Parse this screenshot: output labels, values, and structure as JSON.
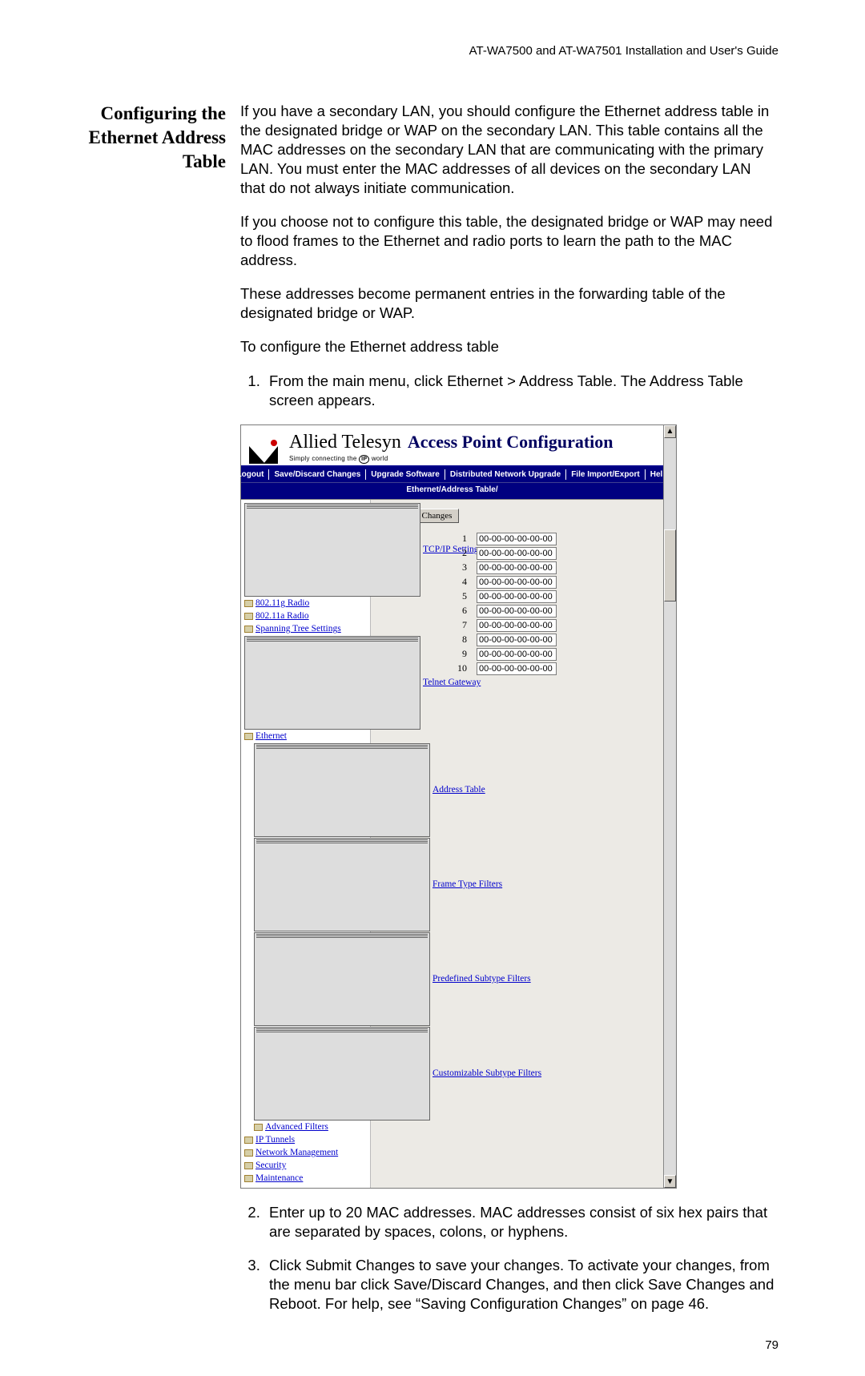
{
  "doc_header": "AT-WA7500 and AT-WA7501 Installation and User's Guide",
  "page_number": "79",
  "section_title": "Configuring the Ethernet Address Table",
  "paragraphs": {
    "p1": "If you have a secondary LAN, you should configure the Ethernet address table in the designated bridge or WAP on the secondary LAN. This table contains all the MAC addresses on the secondary LAN that are communicating with the primary LAN. You must enter the MAC addresses of all devices on the secondary LAN that do not always initiate communication.",
    "p2": "If you choose not to configure this table, the designated bridge or WAP may need to flood frames to the Ethernet and radio ports to learn the path to the MAC address.",
    "p3": "These addresses become permanent entries in the forwarding table of the designated bridge or WAP.",
    "p4": "To configure the Ethernet address table"
  },
  "steps": {
    "s1": "From the main menu, click Ethernet > Address Table. The Address Table screen appears.",
    "s2": "Enter up to 20 MAC addresses. MAC addresses consist of six hex pairs that are separated by spaces, colons, or hyphens.",
    "s3": "Click Submit Changes to save your changes. To activate your changes, from the menu bar click Save/Discard Changes, and then click Save Changes and Reboot. For help, see “Saving Configuration Changes” on page 46."
  },
  "screenshot": {
    "brand_main": "Allied Telesyn",
    "brand_tag_pre": "Simply connecting the ",
    "brand_tag_ip": "IP",
    "brand_tag_post": " world",
    "brand_right": "Access Point Configuration",
    "menu": [
      "Logout",
      "Save/Discard Changes",
      "Upgrade Software",
      "Distributed Network Upgrade",
      "File Import/Export",
      "Help"
    ],
    "crumb": "Ethernet/Address Table/",
    "tree": [
      {
        "type": "page",
        "label": "TCP/IP Settings",
        "indent": 0
      },
      {
        "type": "folder",
        "label": "802.11g Radio",
        "indent": 0
      },
      {
        "type": "folder",
        "label": "802.11a Radio",
        "indent": 0
      },
      {
        "type": "folder",
        "label": "Spanning Tree Settings",
        "indent": 0
      },
      {
        "type": "page",
        "label": "Telnet Gateway",
        "indent": 0
      },
      {
        "type": "folder",
        "label": "Ethernet",
        "indent": 0
      },
      {
        "type": "page",
        "label": "Address Table",
        "indent": 1
      },
      {
        "type": "page",
        "label": "Frame Type Filters",
        "indent": 1
      },
      {
        "type": "page",
        "label": "Predefined Subtype Filters",
        "indent": 1
      },
      {
        "type": "page",
        "label": "Customizable Subtype Filters",
        "indent": 1
      },
      {
        "type": "folder",
        "label": "Advanced Filters",
        "indent": 1
      },
      {
        "type": "folder",
        "label": "IP Tunnels",
        "indent": 0
      },
      {
        "type": "folder",
        "label": "Network Management",
        "indent": 0
      },
      {
        "type": "folder",
        "label": "Security",
        "indent": 0
      },
      {
        "type": "folder",
        "label": "Maintenance",
        "indent": 0
      }
    ],
    "submit_label": "Submit Changes",
    "mac_rows": [
      {
        "n": "1",
        "v": "00-00-00-00-00-00"
      },
      {
        "n": "2",
        "v": "00-00-00-00-00-00"
      },
      {
        "n": "3",
        "v": "00-00-00-00-00-00"
      },
      {
        "n": "4",
        "v": "00-00-00-00-00-00"
      },
      {
        "n": "5",
        "v": "00-00-00-00-00-00"
      },
      {
        "n": "6",
        "v": "00-00-00-00-00-00"
      },
      {
        "n": "7",
        "v": "00-00-00-00-00-00"
      },
      {
        "n": "8",
        "v": "00-00-00-00-00-00"
      },
      {
        "n": "9",
        "v": "00-00-00-00-00-00"
      },
      {
        "n": "10",
        "v": "00-00-00-00-00-00"
      }
    ]
  }
}
